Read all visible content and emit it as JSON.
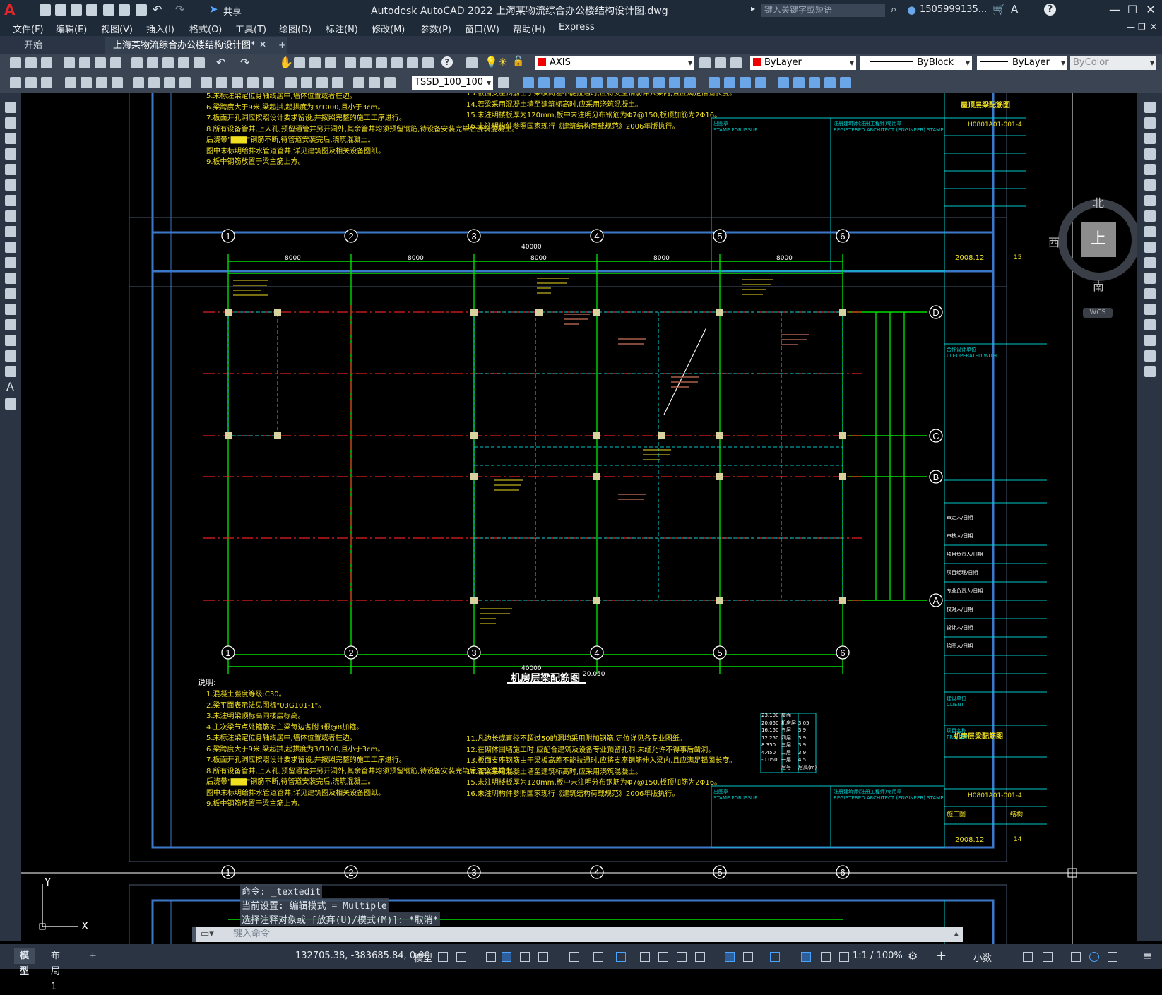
{
  "app": {
    "logo": "A",
    "title": "Autodesk AutoCAD 2022    上海某物流综合办公楼结构设计图.dwg",
    "share_label": "共享",
    "search_placeholder": "键入关键字或短语",
    "user": "1505999135...",
    "help": "?"
  },
  "menu": [
    "文件(F)",
    "编辑(E)",
    "视图(V)",
    "插入(I)",
    "格式(O)",
    "工具(T)",
    "绘图(D)",
    "标注(N)",
    "修改(M)",
    "参数(P)",
    "窗口(W)",
    "帮助(H)",
    "Express"
  ],
  "tabs": {
    "start": "开始",
    "doc": "上海某物流综合办公楼结构设计图*",
    "add": "+"
  },
  "toolbar": {
    "layer_name": "AXIS",
    "color": "ByLayer",
    "linetype": "ByBlock",
    "lineweight": "ByLayer",
    "plotstyle": "ByColor",
    "dimstyle": "TSSD_100_100"
  },
  "viewcube": {
    "north": "北",
    "south": "南",
    "east": "东",
    "west": "西",
    "top": "上",
    "wcs": "WCS"
  },
  "drawing": {
    "plan_title": "机房层梁配筋图",
    "plan_elev": "20.050",
    "grid_cols": [
      "1",
      "2",
      "3",
      "4",
      "5",
      "6"
    ],
    "grid_rows": [
      "D",
      "C",
      "B",
      "A"
    ],
    "dim_total": "40000",
    "dim_bay": "8000",
    "notes_heading": "说明:",
    "notes_left": [
      "1.混凝土强度等级:C30。",
      "2.梁平面表示法见图标\"03G101-1\"。",
      "3.未注明梁顶标高同楼层标高。",
      "4.主次梁节点处箍筋对主梁每边各附3根@8加箍。",
      "5.未标注梁定位身轴线居中,墙体位置或者柱边。",
      "6.梁跨度大于9米,梁起拱,起拱度为3/1000,且小于3cm。",
      "7.板面开孔洞应按照设计要求留设,并按照完整的施工工序进行。",
      "8.所有设备管井,上人孔,预留通管井另开洞外,其余管井均须预留钢筋,待设备安装完毕后浇筑混凝土。",
      "   后浇带\"▇▇▇\"钢筋不断,待管道安装完后,浇筑混凝土。",
      "   图中未标明给排水管道管井,详见建筑图及相关设备图纸。",
      "9.板中钢筋放置于梁主筋上方。"
    ],
    "notes_right": [
      "11.凡边长或直径不超过50的洞均采用附加钢筋,定位详见各专业图纸。",
      "12.在砌体围墙施工时,应配合建筑及设备专业预留孔洞,未经允许不得事后凿洞。",
      "13.板面支座钢筋由于梁板高差不能拉通时,应将支座钢筋伸入梁内,且应满足锚固长度。",
      "14.若梁采用混凝土墙至建筑标高时,应采用浇筑混凝土。",
      "15.未注明楼板厚为120mm,板中未注明分布钢筋为Φ7@150,板顶加筋为2Φ16。",
      "16.未注明构件参照国家现行《建筑结构荷载规范》2006年版执行。"
    ],
    "title_block": {
      "stamp": "出图章\nSTAMP FOR ISSUE",
      "arch_stamp": "注册建筑师(注册工程师)专用章\nREGISTERED ARCHITECT (ENGINEER) STAMP",
      "drawing_no_top": "H0801A01-001-4",
      "drawing_no_bottom": "H0801A01-001-4",
      "status": "施工图",
      "discipline": "结构",
      "date_top": "2008.12",
      "date_bottom": "2008.12",
      "sheet_top": "15",
      "sheet_bottom": "14",
      "title_top": "屋顶层梁配筋图",
      "title_bottom": "机房层梁配筋图",
      "co_op": "合作设计单位\nCO-OPERATED WITH",
      "rows": [
        "审定人/日期",
        "审核人/日期",
        "项目负责人/日期",
        "项目经理/日期",
        "专业负责人/日期",
        "校对人/日期",
        "设计人/日期",
        "绘图人/日期"
      ],
      "client": "建设单位\nCLIENT",
      "project": "项目名称\nPROJECT"
    },
    "elev_table": {
      "rows": [
        [
          "23.100",
          "屋面"
        ],
        [
          "20.050",
          "机房层",
          "3.05"
        ],
        [
          "16.150",
          "五层",
          "3.9"
        ],
        [
          "12.250",
          "四层",
          "3.9"
        ],
        [
          "8.350",
          "三层",
          "3.9"
        ],
        [
          "4.450",
          "二层",
          "3.9"
        ],
        [
          "-0.050",
          "一层",
          "4.5"
        ],
        [
          "",
          "层号",
          "层高(m)"
        ]
      ]
    }
  },
  "command": {
    "history": [
      "命令: _textedit",
      "当前设置: 编辑模式 = Multiple",
      "选择注释对象或 [放弃(U)/模式(M)]: *取消*"
    ],
    "input_placeholder": "键入命令"
  },
  "ucs": {
    "x": "X",
    "y": "Y"
  },
  "status": {
    "model_tab": "模型",
    "layout1_tab": "布局1",
    "add_tab": "+",
    "coords": "132705.38, -383685.84, 0.00",
    "model_space": "模型",
    "scale": "1:1 / 100%",
    "units": "小数"
  }
}
